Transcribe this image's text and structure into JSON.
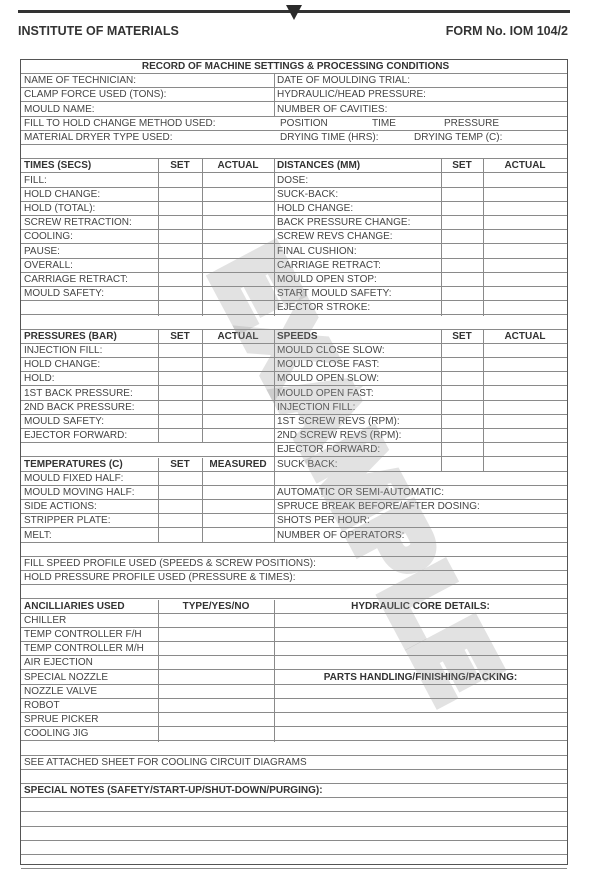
{
  "header": {
    "organization": "INSTITUTE OF MATERIALS",
    "form_number": "FORM No. IOM 104/2"
  },
  "form": {
    "title": "RECORD OF MACHINE SETTINGS & PROCESSING CONDITIONS",
    "general": [
      {
        "left": "NAME OF TECHNICIAN:",
        "right": "DATE OF MOULDING TRIAL:"
      },
      {
        "left": "CLAMP FORCE USED (TONS):",
        "right": "HYDRAULIC/HEAD PRESSURE:"
      },
      {
        "left": "MOULD NAME:",
        "right": "NUMBER OF CAVITIES:"
      }
    ],
    "fill_to_hold": {
      "label": "FILL TO HOLD CHANGE METHOD USED:",
      "options": [
        "POSITION",
        "TIME",
        "PRESSURE"
      ]
    },
    "dryer": {
      "label": "MATERIAL DRYER TYPE USED:",
      "drying_time": "DRYING TIME (HRS):",
      "drying_temp": "DRYING TEMP (C):"
    },
    "times": {
      "header": "TIMES (SECS)",
      "set": "SET",
      "actual": "ACTUAL",
      "rows": [
        "FILL:",
        "HOLD CHANGE:",
        "HOLD (TOTAL):",
        "SCREW RETRACTION:",
        "COOLING:",
        "PAUSE:",
        "OVERALL:",
        "CARRIAGE RETRACT:",
        "MOULD SAFETY:",
        ""
      ]
    },
    "distances": {
      "header": "DISTANCES (MM)",
      "set": "SET",
      "actual": "ACTUAL",
      "rows": [
        "DOSE:",
        "SUCK-BACK:",
        "HOLD CHANGE:",
        "BACK PRESSURE CHANGE:",
        "SCREW REVS CHANGE:",
        "FINAL CUSHION:",
        "CARRIAGE RETRACT:",
        "MOULD OPEN STOP:",
        "START MOULD SAFETY:",
        "EJECTOR STROKE:"
      ]
    },
    "pressures": {
      "header": "PRESSURES (BAR)",
      "set": "SET",
      "actual": "ACTUAL",
      "rows": [
        "INJECTION FILL:",
        "HOLD CHANGE:",
        "HOLD:",
        "1ST BACK PRESSURE:",
        "2ND BACK PRESSURE:",
        "MOULD SAFETY:",
        "EJECTOR FORWARD:"
      ]
    },
    "speeds": {
      "header": "SPEEDS",
      "set": "SET",
      "actual": "ACTUAL",
      "rows": [
        "MOULD CLOSE SLOW:",
        "MOULD CLOSE FAST:",
        "MOULD OPEN SLOW:",
        "MOULD OPEN FAST:",
        "INJECTION FILL:",
        "1ST SCREW REVS (RPM):",
        "2ND SCREW REVS (RPM):",
        "EJECTOR FORWARD:",
        "SUCK BACK:"
      ]
    },
    "temperatures": {
      "header": "TEMPERATURES (C)",
      "set": "SET",
      "measured": "MEASURED",
      "rows": [
        "MOULD FIXED HALF:",
        "MOULD MOVING HALF:",
        "SIDE ACTIONS:",
        "STRIPPER PLATE:",
        "MELT:"
      ]
    },
    "machine": {
      "rows": [
        "",
        "AUTOMATIC OR SEMI-AUTOMATIC:",
        "SPRUCE BREAK BEFORE/AFTER DOSING:",
        "SHOTS PER HOUR:",
        "NUMBER OF OPERATORS:"
      ]
    },
    "profiles": {
      "fill_speed": "FILL SPEED PROFILE USED (SPEEDS & SCREW POSITIONS):",
      "hold_pressure": "HOLD PRESSURE PROFILE USED (PRESSURE & TIMES):"
    },
    "ancillaries": {
      "header": "ANCILLIARIES USED",
      "type": "TYPE/YES/NO",
      "rows": [
        "CHILLER",
        "TEMP CONTROLLER F/H",
        "TEMP CONTROLLER M/H",
        "AIR EJECTION",
        "SPECIAL NOZZLE",
        "NOZZLE VALVE",
        "ROBOT",
        "SPRUE PICKER",
        "COOLING JIG"
      ]
    },
    "hydraulic_core": "HYDRAULIC CORE DETAILS:",
    "parts_handling": "PARTS HANDLING/FINISHING/PACKING:",
    "cooling_note": "SEE ATTACHED SHEET FOR COOLING CIRCUIT DIAGRAMS",
    "special_notes": "SPECIAL NOTES (SAFETY/START-UP/SHUT-DOWN/PURGING):"
  },
  "watermark": "EXAMPLE"
}
